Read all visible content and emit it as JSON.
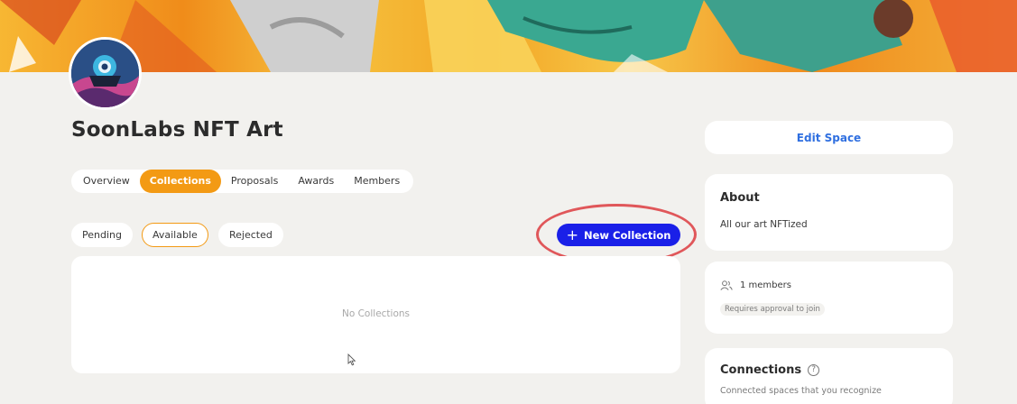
{
  "space": {
    "name": "SoonLabs NFT Art"
  },
  "tabs": [
    {
      "label": "Overview"
    },
    {
      "label": "Collections"
    },
    {
      "label": "Proposals"
    },
    {
      "label": "Awards"
    },
    {
      "label": "Members"
    }
  ],
  "active_tab": "Collections",
  "filters": [
    {
      "label": "Pending"
    },
    {
      "label": "Available"
    },
    {
      "label": "Rejected"
    }
  ],
  "active_filter": "Available",
  "new_collection": {
    "label": "New Collection",
    "icon": "plus-icon"
  },
  "collections": {
    "empty_text": "No Collections"
  },
  "sidebar": {
    "edit_label": "Edit Space",
    "about": {
      "title": "About",
      "description": "All our art NFTized"
    },
    "members": {
      "count_text": "1 members",
      "requirement": "Requires approval to join",
      "icon": "users-icon"
    },
    "connections": {
      "title": "Connections",
      "subtitle": "Connected spaces that you recognize",
      "icon": "question-icon"
    }
  },
  "colors": {
    "accent": "#f39a14",
    "primary_button": "#1a20e8",
    "link": "#2f6fe0",
    "highlight": "#e0575a",
    "background": "#f2f1ee"
  }
}
